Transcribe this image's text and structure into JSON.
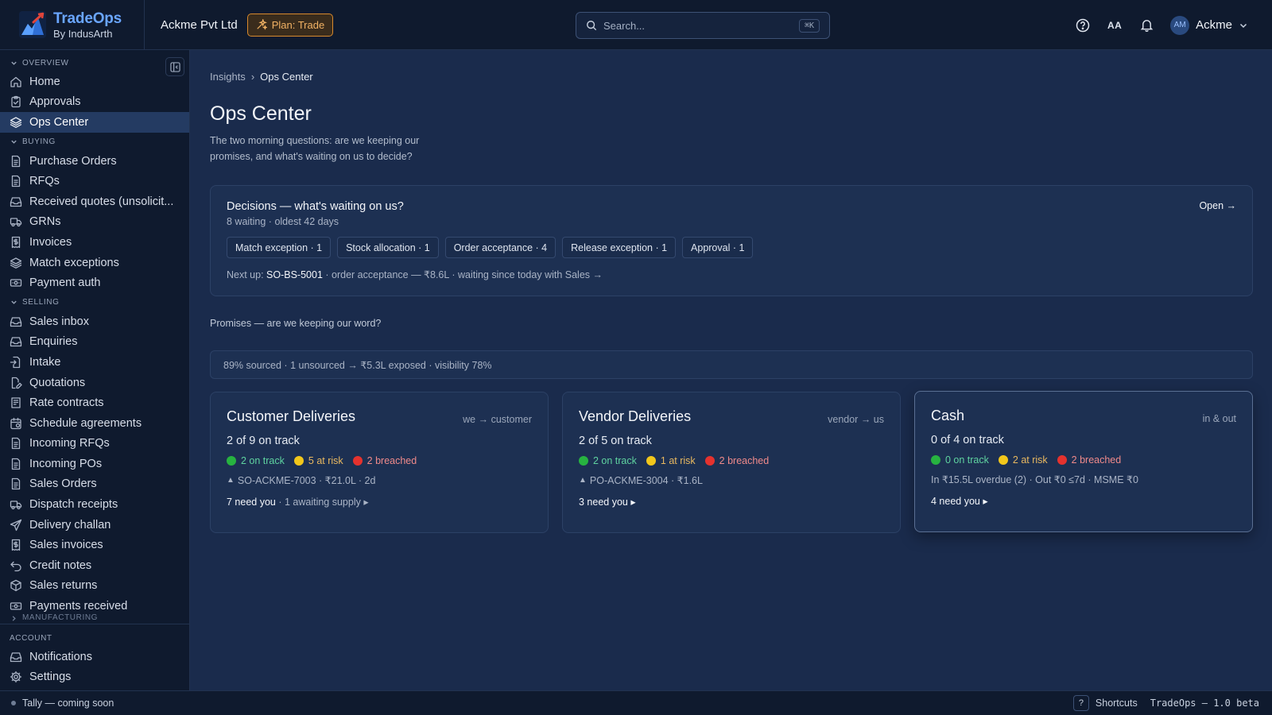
{
  "brand": {
    "name": "TradeOps",
    "sub": "By IndusArth"
  },
  "org": "Ackme Pvt Ltd",
  "plan_badge": "Plan: Trade",
  "search": {
    "placeholder": "Search...",
    "shortcut": "⌘K"
  },
  "header": {
    "font_toggle": "AA",
    "user_initials": "AM",
    "user_name": "Ackme"
  },
  "sidebar": {
    "overview_head": "OVERVIEW",
    "overview": [
      {
        "label": "Home",
        "icon": "home-icon"
      },
      {
        "label": "Approvals",
        "icon": "clipboard-check-icon"
      },
      {
        "label": "Ops Center",
        "icon": "layers-icon",
        "active": true
      }
    ],
    "buying_head": "BUYING",
    "buying": [
      {
        "label": "Purchase Orders",
        "icon": "document-icon"
      },
      {
        "label": "RFQs",
        "icon": "document-icon"
      },
      {
        "label": "Received quotes (unsolicit...",
        "icon": "inbox-icon"
      },
      {
        "label": "GRNs",
        "icon": "truck-icon"
      },
      {
        "label": "Invoices",
        "icon": "receipt-icon"
      },
      {
        "label": "Match exceptions",
        "icon": "layers-icon"
      },
      {
        "label": "Payment auth",
        "icon": "banknote-icon"
      }
    ],
    "selling_head": "SELLING",
    "selling": [
      {
        "label": "Sales inbox",
        "icon": "inbox-icon"
      },
      {
        "label": "Enquiries",
        "icon": "inbox-icon"
      },
      {
        "label": "Intake",
        "icon": "file-import-icon"
      },
      {
        "label": "Quotations",
        "icon": "file-edit-icon"
      },
      {
        "label": "Rate contracts",
        "icon": "contract-icon"
      },
      {
        "label": "Schedule agreements",
        "icon": "calendar-icon"
      },
      {
        "label": "Incoming RFQs",
        "icon": "document-icon"
      },
      {
        "label": "Incoming POs",
        "icon": "document-icon"
      },
      {
        "label": "Sales Orders",
        "icon": "document-icon"
      },
      {
        "label": "Dispatch receipts",
        "icon": "truck-icon"
      },
      {
        "label": "Delivery challan",
        "icon": "send-icon"
      },
      {
        "label": "Sales invoices",
        "icon": "receipt-icon"
      },
      {
        "label": "Credit notes",
        "icon": "undo-icon"
      },
      {
        "label": "Sales returns",
        "icon": "package-return-icon"
      },
      {
        "label": "Payments received",
        "icon": "banknote-icon"
      }
    ],
    "manufacturing_head": "MANUFACTURING",
    "account_head": "ACCOUNT",
    "account": [
      {
        "label": "Notifications",
        "icon": "inbox-icon"
      },
      {
        "label": "Settings",
        "icon": "gear-icon"
      }
    ]
  },
  "footer": {
    "tally": "Tally — coming soon",
    "shortcut_key": "?",
    "shortcuts": "Shortcuts",
    "version": "TradeOps — 1.0 beta"
  },
  "breadcrumb": {
    "parent": "Insights",
    "separator": "›",
    "current": "Ops Center"
  },
  "page": {
    "title": "Ops Center",
    "subtitle": "The two morning questions: are we keeping our promises, and what's waiting on us to decide?"
  },
  "decisions": {
    "title": "Decisions — what's waiting on us?",
    "meta": "8 waiting · oldest 42 days",
    "open": "Open →",
    "chips": [
      "Match exception · 1",
      "Stock allocation · 1",
      "Order acceptance · 4",
      "Release exception · 1",
      "Approval · 1"
    ],
    "next_prefix": "Next up: ",
    "next_ref": "SO-BS-5001",
    "next_rest": " · order acceptance — ₹8.6L · waiting since today with Sales →"
  },
  "promises": {
    "heading": "Promises — are we keeping our word?",
    "summary": "89% sourced · 1 unsourced → ₹5.3L exposed · visibility 78%",
    "cards": [
      {
        "title": "Customer Deliveries",
        "direction": "we → customer",
        "track": "2 of 9 on track",
        "on_track": "2 on track",
        "at_risk": "5 at risk",
        "breached": "2 breached",
        "detail": "SO-ACKME-7003 · ₹21.0L · 2d",
        "need": "7 need you",
        "need_extra": " · 1 awaiting supply ▸"
      },
      {
        "title": "Vendor Deliveries",
        "direction": "vendor → us",
        "track": "2 of 5 on track",
        "on_track": "2 on track",
        "at_risk": "1 at risk",
        "breached": "2 breached",
        "detail": "PO-ACKME-3004 · ₹1.6L",
        "need": "3 need you ▸",
        "need_extra": ""
      },
      {
        "title": "Cash",
        "direction": "in & out",
        "track": "0 of 4 on track",
        "on_track": "0 on track",
        "at_risk": "2 at risk",
        "breached": "2 breached",
        "detail": "In ₹15.5L overdue (2) · Out ₹0 ≤7d · MSME ₹0",
        "need": "4 need you ▸",
        "need_extra": ""
      }
    ]
  },
  "colors": {
    "accent": "#6aa6ff",
    "plan": "#f2b264",
    "green": "#27b340",
    "yellow": "#f2c71b",
    "red": "#e5322e"
  }
}
